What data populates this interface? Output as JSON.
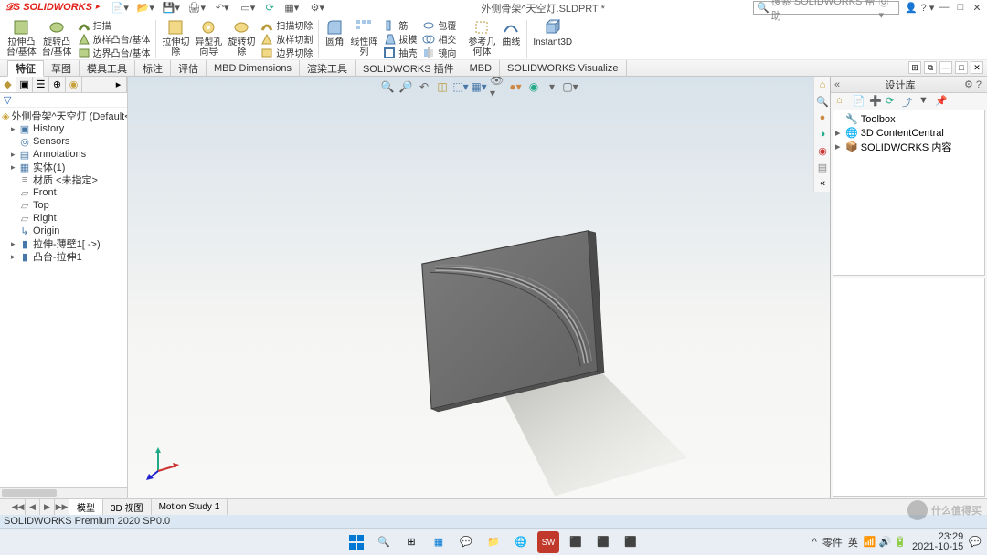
{
  "app": {
    "name": "SOLIDWORKS",
    "title_doc": "外侧骨架^天空灯.SLDPRT *"
  },
  "search": {
    "placeholder": "搜索 SOLIDWORKS 帮助"
  },
  "ribbon": {
    "b1": "拉伸凸\n台/基体",
    "b2": "旋转凸\n台/基体",
    "s1": "扫描",
    "s2": "放样凸台/基体",
    "s3": "边界凸台/基体",
    "b3": "拉伸切\n除",
    "b4": "异型孔\n向导",
    "b5": "旋转切\n除",
    "s4": "扫描切除",
    "s5": "放样切割",
    "s6": "边界切除",
    "b6": "圆角",
    "b7": "线性阵\n列",
    "b8": "筋",
    "b9": "拔模",
    "b10": "抽壳",
    "s7": "包覆",
    "s8": "相交",
    "s9": "镜向",
    "b11": "参考几\n何体",
    "b12": "曲线",
    "b13": "Instant3D"
  },
  "tabs": [
    "特征",
    "草图",
    "模具工具",
    "标注",
    "评估",
    "MBD Dimensions",
    "渲染工具",
    "SOLIDWORKS 插件",
    "MBD",
    "SOLIDWORKS Visualize"
  ],
  "tree": {
    "root": "外侧骨架^天空灯  (Default<<Default>",
    "items": [
      "History",
      "Sensors",
      "Annotations",
      "实体(1)",
      "材质 <未指定>",
      "Front",
      "Top",
      "Right",
      "Origin",
      "拉伸-薄壁1[ ->)",
      "凸台-拉伸1"
    ]
  },
  "taskpane": {
    "title": "设计库",
    "items": [
      {
        "label": "Toolbox",
        "color": "#9a7a2a"
      },
      {
        "label": "3D ContentCentral",
        "color": "#2a6aa8"
      },
      {
        "label": "SOLIDWORKS 内容",
        "color": "#c0392b"
      }
    ]
  },
  "bottom_tabs": [
    "模型",
    "3D 视图",
    "Motion Study 1"
  ],
  "status": {
    "text": "SOLIDWORKS Premium 2020 SP0.0"
  },
  "tray": {
    "zero": "零件",
    "ime": "英",
    "time": "23:29",
    "date": "2021-10-15"
  },
  "watermark": "什么值得买"
}
